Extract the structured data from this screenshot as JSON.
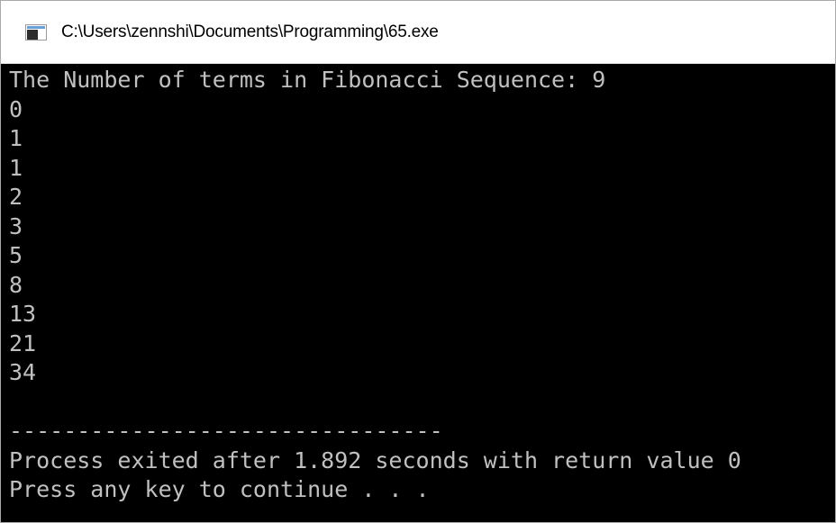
{
  "window": {
    "title": "C:\\Users\\zennshi\\Documents\\Programming\\65.exe",
    "icon": "console-window-icon"
  },
  "console": {
    "prompt_line": "The Number of terms in Fibonacci Sequence: 9",
    "outputs": [
      "0",
      "1",
      "1",
      "2",
      "3",
      "5",
      "8",
      "13",
      "21",
      "34"
    ],
    "blank_line": "",
    "separator": "--------------------------------",
    "exit_message": "Process exited after 1.892 seconds with return value 0",
    "continue_message": "Press any key to continue . . ."
  },
  "colors": {
    "console_background": "#000000",
    "console_text": "#c0c0c0",
    "titlebar_background": "#ffffff"
  }
}
